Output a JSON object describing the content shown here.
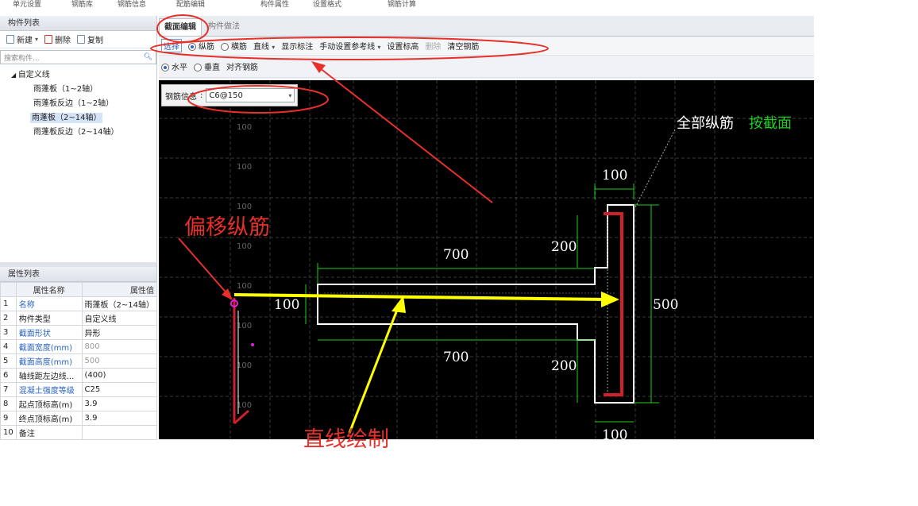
{
  "top_strip": [
    "单元设置",
    "钢筋库",
    "钢筋信息",
    "配筋编辑",
    "构件属性",
    "设置格式",
    "钢筋计算",
    "构件做法"
  ],
  "component_list": {
    "title": "构件列表",
    "toolbar": {
      "new": "新建",
      "delete": "删除",
      "copy": "复制"
    },
    "search_placeholder": "搜索构件...",
    "tree": {
      "root": "自定义线",
      "items": [
        "雨蓬板（1~2轴）",
        "雨蓬板反边（1~2轴）",
        "雨蓬板（2~14轴）",
        "雨蓬板反边（2~14轴）"
      ]
    }
  },
  "property_list": {
    "title": "属性列表",
    "headers": {
      "name": "属性名称",
      "value": "属性值"
    },
    "rows": [
      {
        "no": "1",
        "name": "名称",
        "value": "雨蓬板（2~14轴）"
      },
      {
        "no": "2",
        "name": "构件类型",
        "value": "自定义线"
      },
      {
        "no": "3",
        "name": "截面形状",
        "value": "异形"
      },
      {
        "no": "4",
        "name": "截面宽度(mm)",
        "value": "800"
      },
      {
        "no": "5",
        "name": "截面高度(mm)",
        "value": "500"
      },
      {
        "no": "6",
        "name": "轴线距左边线...",
        "value": "(400)"
      },
      {
        "no": "7",
        "name": "混凝土强度等级",
        "value": "C25"
      },
      {
        "no": "8",
        "name": "起点顶标高(m)",
        "value": "3.9"
      },
      {
        "no": "9",
        "name": "终点顶标高(m)",
        "value": "3.9"
      },
      {
        "no": "10",
        "name": "备注",
        "value": ""
      }
    ]
  },
  "tabs": {
    "section_edit": "截面编辑",
    "method": "构件做法"
  },
  "edit_toolbar": {
    "select": "选择",
    "longitudinal": "纵筋",
    "transverse": "横筋",
    "line": "直线",
    "show_label": "显示标注",
    "manual_ref": "手动设置参考线",
    "set_elevation": "设置标高",
    "delete": "删除",
    "clear": "清空钢筋"
  },
  "align_row": {
    "horizontal": "水平",
    "vertical": "垂直",
    "align": "对齐钢筋"
  },
  "rebar_info": {
    "label": "钢筋信息",
    "value": "C6@150"
  },
  "drawing": {
    "all_long_label": "全部纵筋",
    "by_section": "按截面",
    "dims": {
      "top": "100",
      "flange_top": "200",
      "flange_bottom": "200",
      "bottom": "100",
      "slab_left": "700",
      "slab_bottom": "700",
      "slab_thick": "100",
      "height": "500"
    },
    "grid_label": "100"
  },
  "annotations": {
    "offset": "偏移纵筋",
    "line_draw": "直线绘制"
  },
  "colors": {
    "annotation_red": "#e8302a",
    "arrow_yellow": "#ffff00",
    "dim_green": "#22cc22",
    "rebar_red": "#d0202a"
  }
}
